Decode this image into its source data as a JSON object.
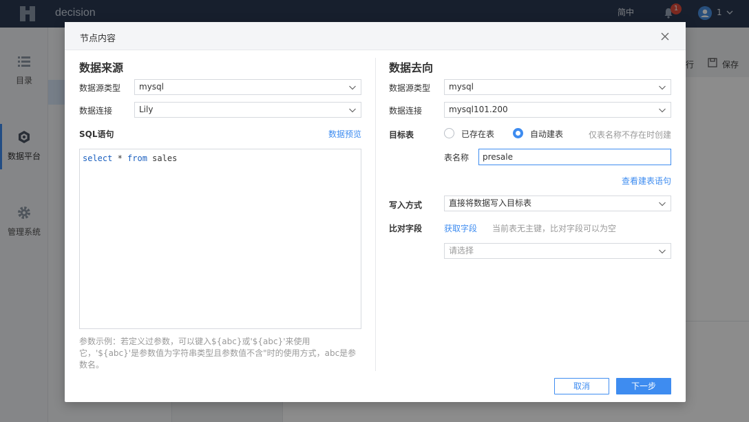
{
  "topbar": {
    "app_name": "decision",
    "lang": "简中",
    "notification_count": "1",
    "user_name": "1"
  },
  "sidebar": {
    "items": [
      {
        "label": "目录",
        "icon": "list-icon"
      },
      {
        "label": "数据平台",
        "icon": "data-platform-icon"
      },
      {
        "label": "管理系统",
        "icon": "gear-icon"
      }
    ]
  },
  "background_toolbar": {
    "run_label": "行",
    "save_label": "保存"
  },
  "dialog": {
    "title": "节点内容",
    "source": {
      "title": "数据来源",
      "type_label": "数据源类型",
      "type_value": "mysql",
      "conn_label": "数据连接",
      "conn_value": "Lily",
      "sql_label": "SQL语句",
      "preview_link": "数据预览",
      "sql_tokens": [
        "select",
        " * ",
        "from",
        " sales"
      ],
      "help_text": "参数示例：若定义过参数，可以键入${abc}或'${abc}'来使用它，'${abc}'是参数值为字符串类型且参数值不含\"时的使用方式，abc是参数名。"
    },
    "target": {
      "title": "数据去向",
      "type_label": "数据源类型",
      "type_value": "mysql",
      "conn_label": "数据连接",
      "conn_value": "mysql101.200",
      "table_label": "目标表",
      "radio_existing": "已存在表",
      "radio_auto": "自动建表",
      "radio_hint": "仅表名称不存在时创建",
      "table_name_label": "表名称",
      "table_name_value": "presale",
      "view_ddl_link": "查看建表语句",
      "write_label": "写入方式",
      "write_value": "直接将数据写入目标表",
      "compare_label": "比对字段",
      "fetch_link": "获取字段",
      "compare_hint": "当前表无主键，比对字段可以为空",
      "compare_placeholder": "请选择"
    },
    "buttons": {
      "cancel": "取消",
      "next": "下一步"
    }
  },
  "colors": {
    "accent": "#3e8cf0",
    "topbar": "#2b3a52"
  }
}
